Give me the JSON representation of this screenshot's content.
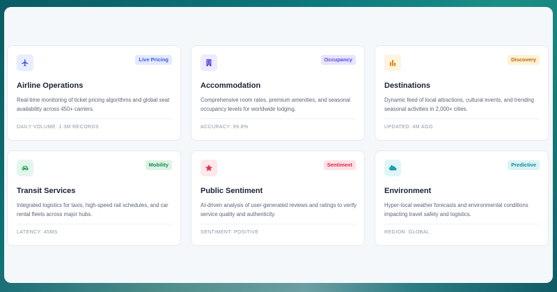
{
  "cards": [
    {
      "title": "Airline Operations",
      "badge": "Live Pricing",
      "icon": "airplane-icon",
      "description": "Real-time monitoring of ticket pricing algorithms and global seat availability across 450+ carriers.",
      "meta": "DAILY VOLUME: 1.3M RECORDS",
      "accent": "#3b5bdb",
      "icon_bg": "#e8edff",
      "badge_bg": "#e3e9ff",
      "badge_color": "#3b5bdb"
    },
    {
      "title": "Accommodation",
      "badge": "Occupancy",
      "icon": "building-icon",
      "description": "Comprehensive room rates, premium amenities, and seasonal occupancy levels for worldwide lodging.",
      "meta": "ACCURACY: 99.8%",
      "accent": "#5b4ce6",
      "icon_bg": "#ecebff",
      "badge_bg": "#e6e4ff",
      "badge_color": "#5b4ce6"
    },
    {
      "title": "Destinations",
      "badge": "Discovery",
      "icon": "map-icon",
      "description": "Dynamic feed of local attractions, cultural events, and trending seasonal activities in 2,000+ cities.",
      "meta": "UPDATED: 4M AGO",
      "accent": "#e0870b",
      "icon_bg": "#fff4e0",
      "badge_bg": "#fff1d6",
      "badge_color": "#b8690a"
    },
    {
      "title": "Transit Services",
      "badge": "Mobility",
      "icon": "car-icon",
      "description": "Integrated logistics for taxis, high-speed rail schedules, and car rental fleets across major hubs.",
      "meta": "LATENCY: 45MS",
      "accent": "#1e9e5a",
      "icon_bg": "#e4f6ec",
      "badge_bg": "#dcf3e5",
      "badge_color": "#1a8a4f"
    },
    {
      "title": "Public Sentiment",
      "badge": "Sentiment",
      "icon": "star-icon",
      "description": "AI-driven analysis of user-generated reviews and ratings to verify service quality and authenticity.",
      "meta": "SENTIMENT: POSITIVE",
      "accent": "#e0334f",
      "icon_bg": "#fde8ec",
      "badge_bg": "#fde1e6",
      "badge_color": "#d02c48"
    },
    {
      "title": "Environment",
      "badge": "Predictive",
      "icon": "cloud-sun-icon",
      "description": "Hyper-local weather forecasts and environmental conditions impacting travel safety and logistics.",
      "meta": "REGION: GLOBAL",
      "accent": "#1a9fb0",
      "icon_bg": "#e0f5f7",
      "badge_bg": "#daf3f5",
      "badge_color": "#148a99"
    }
  ]
}
